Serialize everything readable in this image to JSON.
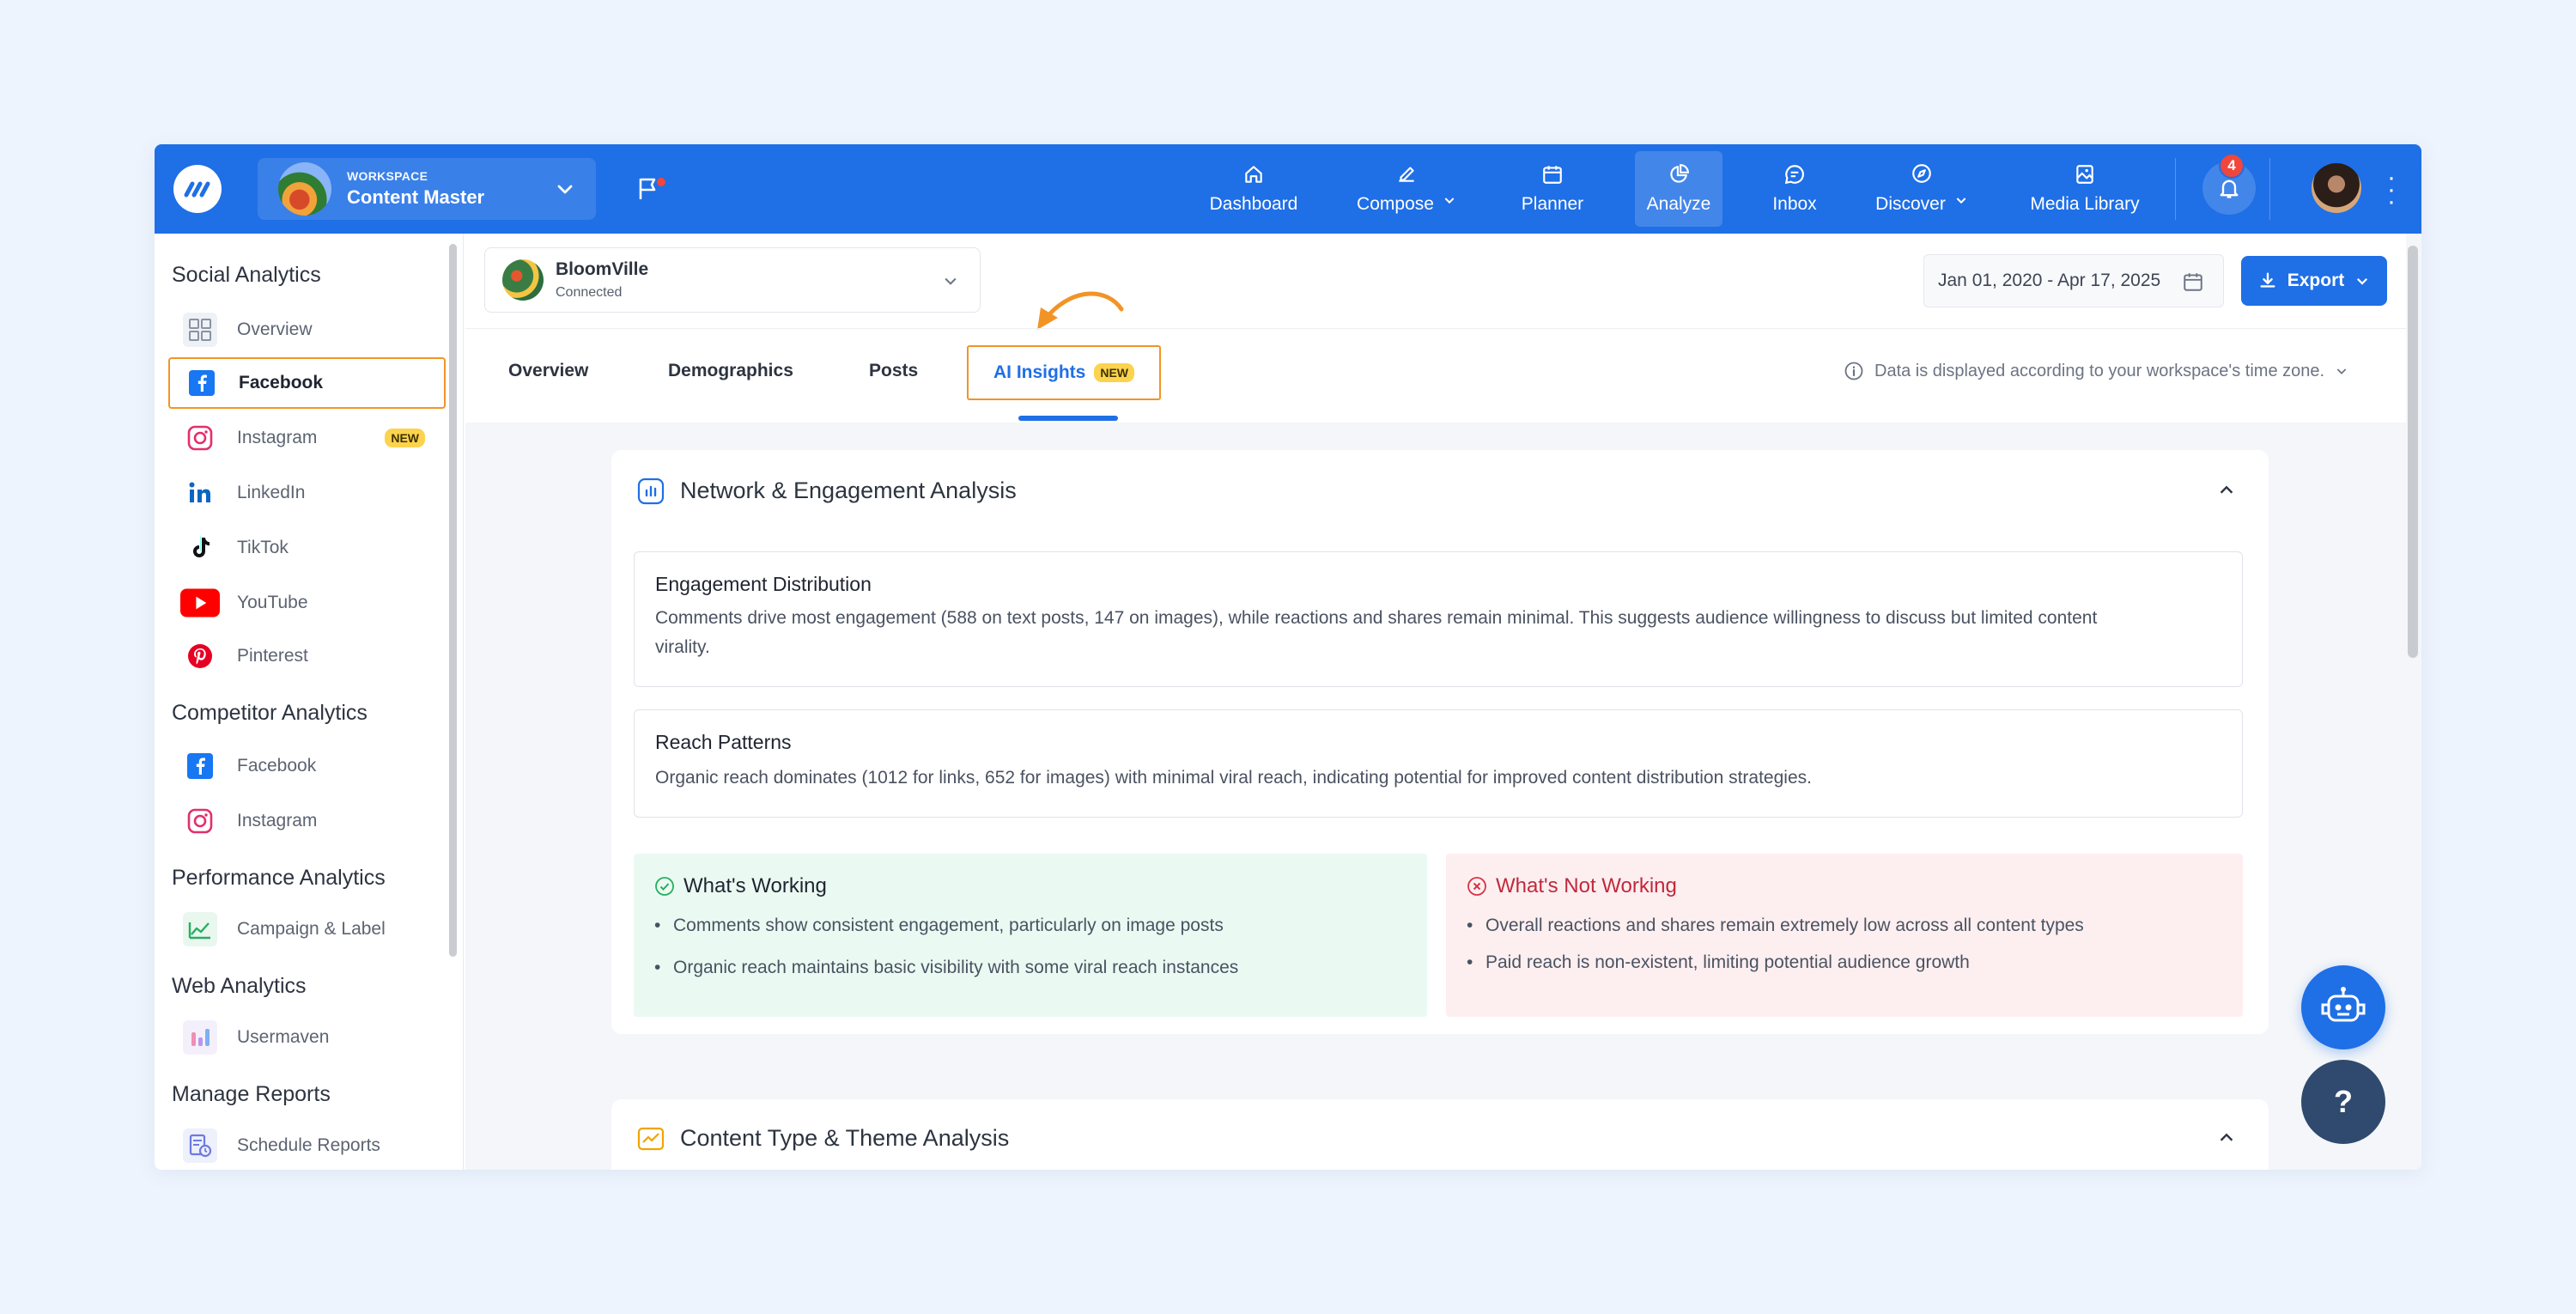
{
  "topbar": {
    "workspace_label": "WORKSPACE",
    "workspace_name": "Content Master",
    "notification_count": "4",
    "nav": [
      {
        "label": "Dashboard",
        "icon": "home-icon"
      },
      {
        "label": "Compose",
        "icon": "pencil-icon"
      },
      {
        "label": "Planner",
        "icon": "calendar-icon"
      },
      {
        "label": "Analyze",
        "icon": "pie-chart-icon",
        "active": true
      },
      {
        "label": "Inbox",
        "icon": "chat-bubble-icon"
      },
      {
        "label": "Discover",
        "icon": "compass-icon"
      },
      {
        "label": "Media Library",
        "icon": "image-icon"
      }
    ]
  },
  "sidebar": {
    "sections": [
      {
        "title": "Social Analytics",
        "items": [
          "Overview",
          "Facebook",
          "Instagram",
          "LinkedIn",
          "TikTok",
          "YouTube",
          "Pinterest"
        ]
      },
      {
        "title": "Competitor Analytics",
        "items": [
          "Facebook",
          "Instagram"
        ]
      },
      {
        "title": "Performance Analytics",
        "items": [
          "Campaign & Label"
        ]
      },
      {
        "title": "Web Analytics",
        "items": [
          "Usermaven"
        ]
      },
      {
        "title": "Manage Reports",
        "items": [
          "Schedule Reports"
        ]
      }
    ],
    "new_tag": "NEW"
  },
  "account": {
    "name": "BloomVille",
    "status": "Connected"
  },
  "date_range": "Jan 01, 2020 - Apr 17, 2025",
  "export_label": "Export",
  "tabs": [
    "Overview",
    "Demographics",
    "Posts",
    "AI Insights"
  ],
  "tab_new_tag": "NEW",
  "timezone_note": "Data is displayed according to your workspace's time zone.",
  "network_card": {
    "title": "Network & Engagement Analysis",
    "engagement": {
      "title": "Engagement Distribution",
      "line1": "Comments drive most engagement (588 on text posts, 147 on images), while reactions and shares remain minimal. This suggests audience willingness to discuss but limited content",
      "line2": "virality."
    },
    "reach": {
      "title": "Reach Patterns",
      "text": "Organic reach dominates (1012 for links, 652 for images) with minimal viral reach, indicating potential for improved content distribution strategies."
    },
    "working": {
      "title": "What's Working",
      "items": [
        "Comments show consistent engagement, particularly on image posts",
        "Organic reach maintains basic visibility with some viral reach instances"
      ]
    },
    "not_working": {
      "title": "What's Not Working",
      "items": [
        "Overall reactions and shares remain extremely low across all content types",
        "Paid reach is non-existent, limiting potential audience growth"
      ]
    }
  },
  "content_card": {
    "title": "Content Type & Theme Analysis"
  },
  "help_label": "?",
  "colors": {
    "brand": "#1f6fe6",
    "highlight": "#f29425",
    "working_bg": "#eafaf2",
    "not_working_bg": "#fdeff0"
  }
}
